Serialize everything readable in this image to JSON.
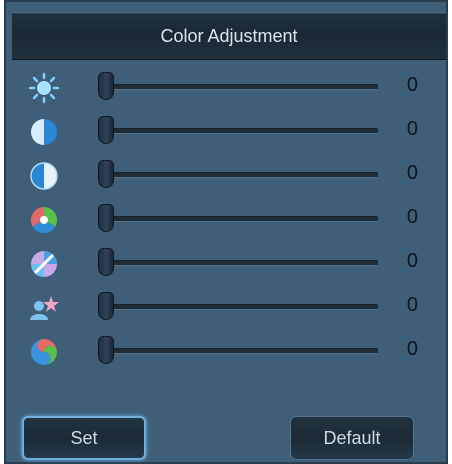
{
  "panel": {
    "title": "Color Adjustment"
  },
  "sliders": [
    {
      "id": "brightness",
      "icon": "brightness-sun-icon",
      "value": "0",
      "level": 0
    },
    {
      "id": "contrast",
      "icon": "contrast-icon",
      "value": "0",
      "level": 0
    },
    {
      "id": "saturation",
      "icon": "saturation-icon",
      "value": "0",
      "level": 0
    },
    {
      "id": "hue",
      "icon": "hue-rgb-icon",
      "value": "0",
      "level": 0
    },
    {
      "id": "sharpness",
      "icon": "sharpness-icon",
      "value": "0",
      "level": 0
    },
    {
      "id": "skin-tone",
      "icon": "person-star-icon",
      "value": "0",
      "level": 0
    },
    {
      "id": "color-cycle",
      "icon": "color-swirl-icon",
      "value": "0",
      "level": 0
    }
  ],
  "buttons": {
    "set_label": "Set",
    "default_label": "Default"
  }
}
